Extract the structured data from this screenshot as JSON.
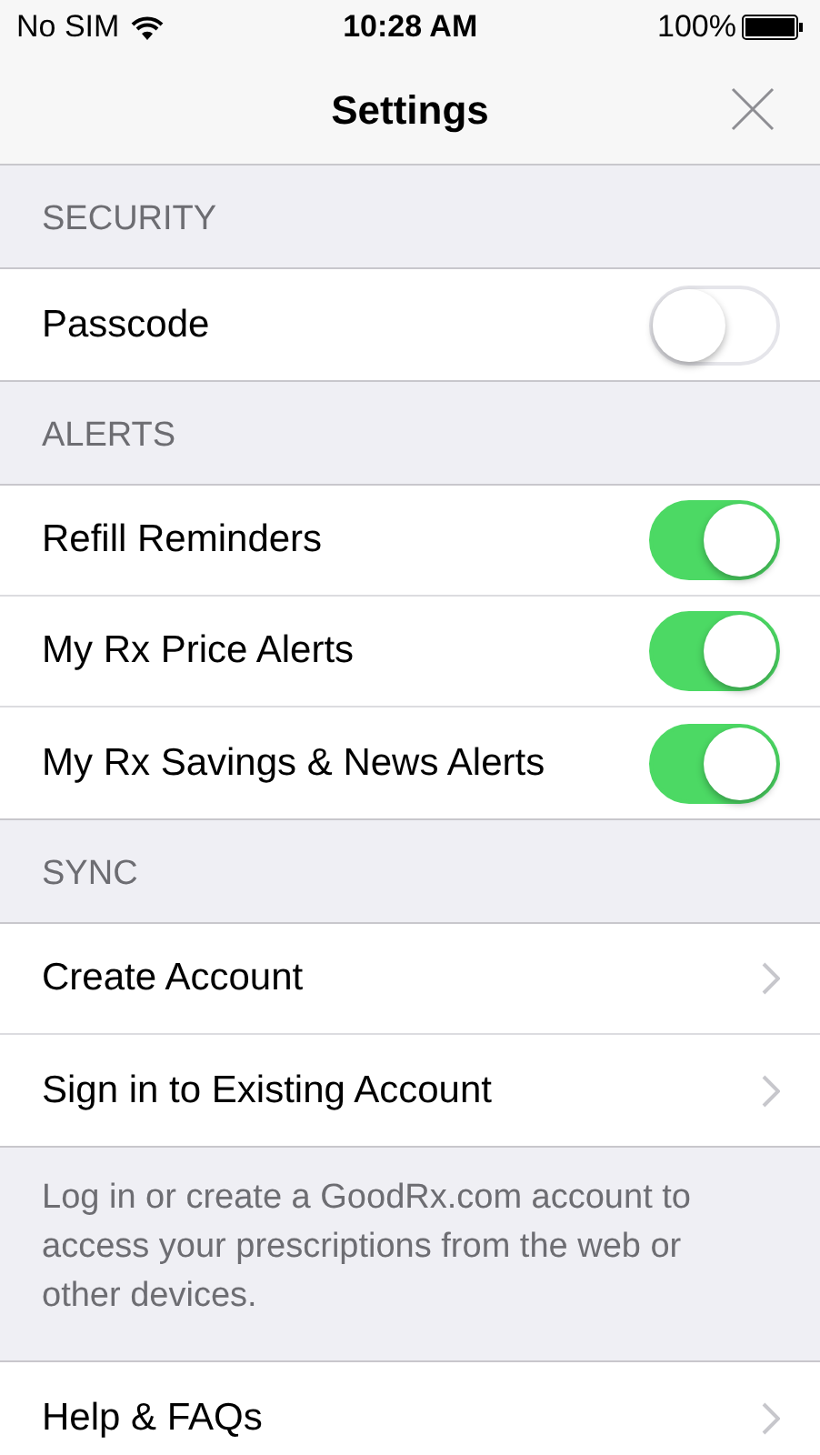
{
  "status_bar": {
    "carrier": "No SIM",
    "time": "10:28 AM",
    "battery": "100%"
  },
  "nav": {
    "title": "Settings"
  },
  "sections": [
    {
      "header": "SECURITY",
      "rows": [
        {
          "kind": "toggle",
          "label": "Passcode",
          "on": false
        }
      ]
    },
    {
      "header": "ALERTS",
      "rows": [
        {
          "kind": "toggle",
          "label": "Refill Reminders",
          "on": true
        },
        {
          "kind": "toggle",
          "label": "My Rx Price Alerts",
          "on": true
        },
        {
          "kind": "toggle",
          "label": "My Rx Savings & News Alerts",
          "on": true
        }
      ]
    },
    {
      "header": "SYNC",
      "rows": [
        {
          "kind": "link",
          "label": "Create Account"
        },
        {
          "kind": "link",
          "label": "Sign in to Existing Account"
        }
      ],
      "footer": "Log in or create a GoodRx.com account to access your prescriptions from the web or other devices."
    },
    {
      "rows": [
        {
          "kind": "link",
          "label": "Help & FAQs"
        }
      ]
    }
  ]
}
